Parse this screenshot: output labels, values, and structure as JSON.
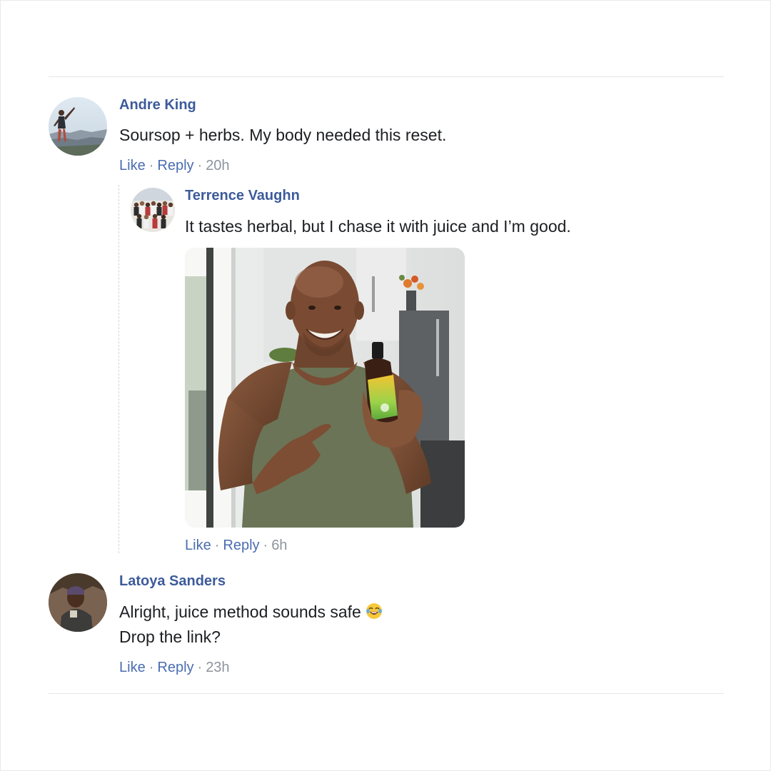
{
  "comments": [
    {
      "author": "Andre King",
      "text": "Soursop + herbs. My body needed this reset.",
      "like_label": "Like",
      "reply_label": "Reply",
      "time": "20h",
      "replies": [
        {
          "author": "Terrence Vaughn",
          "text": "It tastes herbal, but I chase it with juice and I’m good.",
          "has_photo": true,
          "like_label": "Like",
          "reply_label": "Reply",
          "time": "6h"
        }
      ]
    },
    {
      "author": "Latoya Sanders",
      "text_line1": "Alright, juice method sounds safe",
      "emoji": "face-with-tears-of-joy",
      "text_line2": "Drop the link?",
      "like_label": "Like",
      "reply_label": "Reply",
      "time": "23h"
    }
  ],
  "colors": {
    "author_name": "#3d5b9b",
    "action_link": "#4a6db0",
    "timestamp": "#8d949e",
    "body_text": "#1c1e21"
  }
}
